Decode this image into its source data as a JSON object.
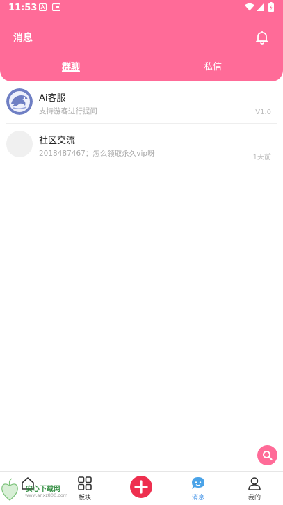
{
  "status_bar": {
    "time": "11:53",
    "icons": [
      "notification-a-icon",
      "screen-icon",
      "wifi-icon",
      "signal-icon",
      "battery-icon"
    ]
  },
  "header": {
    "title": "消息",
    "bell_icon": "bell-icon",
    "background_color": "#ff6b98",
    "tabs": [
      {
        "label": "群聊",
        "active": true
      },
      {
        "label": "私信",
        "active": false
      }
    ]
  },
  "chats": [
    {
      "name": "Ai客服",
      "preview": "支持游客进行提问",
      "meta": "V1.0",
      "avatar": "dolphin-avatar-icon"
    },
    {
      "name": "社区交流",
      "preview": "2018487467：怎么领取永久vip呀",
      "meta": "1天前",
      "avatar": "blank-avatar"
    }
  ],
  "fab": {
    "icon": "search-icon"
  },
  "bottom_nav": [
    {
      "label": "",
      "icon": "home-icon",
      "active": false
    },
    {
      "label": "板块",
      "icon": "grid-icon",
      "active": false
    },
    {
      "label": "",
      "icon": "plus-icon",
      "active": false
    },
    {
      "label": "消息",
      "icon": "chat-bubble-icon",
      "active": true
    },
    {
      "label": "我的",
      "icon": "person-icon",
      "active": false
    }
  ],
  "watermark": {
    "text": "安心下载网",
    "url": "www.anxz800.com"
  }
}
